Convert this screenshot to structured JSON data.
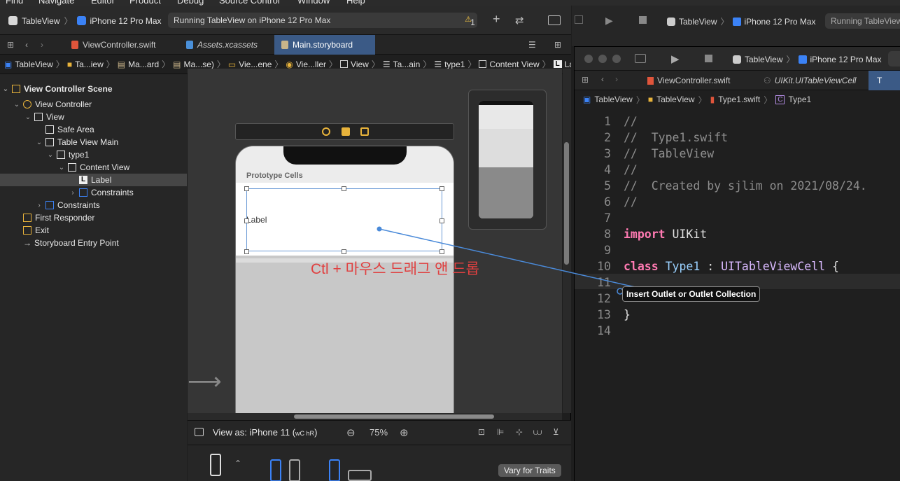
{
  "menubar": {
    "items": [
      "Find",
      "Navigate",
      "Editor",
      "Product",
      "Debug",
      "Source Control",
      "Window",
      "Help"
    ]
  },
  "left_toolbar": {
    "scheme": "TableView",
    "device": "iPhone 12 Pro Max",
    "status": "Running TableView on iPhone 12 Pro Max",
    "warning_count": "1"
  },
  "tabs": [
    {
      "label": "ViewController.swift",
      "active": false
    },
    {
      "label": "Assets.xcassets",
      "active": false
    },
    {
      "label": "Main.storyboard",
      "active": true
    }
  ],
  "jumpbar": [
    "TableView",
    "Ta...iew",
    "Ma...ard",
    "Ma...se)",
    "Vie...ene",
    "Vie...ller",
    "View",
    "Ta...ain",
    "type1",
    "Content View",
    "Label"
  ],
  "outline": [
    {
      "label": "View Controller Scene",
      "level": 0,
      "bold": true
    },
    {
      "label": "View Controller",
      "level": 1
    },
    {
      "label": "View",
      "level": 2
    },
    {
      "label": "Safe Area",
      "level": 3
    },
    {
      "label": "Table View Main",
      "level": 3
    },
    {
      "label": "type1",
      "level": 4
    },
    {
      "label": "Content View",
      "level": 5
    },
    {
      "label": "Label",
      "level": 6,
      "selected": true
    },
    {
      "label": "Constraints",
      "level": 6
    },
    {
      "label": "Constraints",
      "level": 3
    },
    {
      "label": "First Responder",
      "level": 1
    },
    {
      "label": "Exit",
      "level": 1
    },
    {
      "label": "Storyboard Entry Point",
      "level": 1
    }
  ],
  "canvas": {
    "prototype_cells": "Prototype Cells",
    "cell_label": "Label"
  },
  "bottom": {
    "view_as": "View as: iPhone 11 (",
    "view_as_size": "wC hR",
    "view_as_close": ")",
    "zoom": "75%",
    "vary_button": "Vary for Traits"
  },
  "right_back": {
    "scheme": "TableView",
    "device": "iPhone 12 Pro Max",
    "status": "Running TableView"
  },
  "right_window": {
    "scheme": "TableView",
    "device": "iPhone 12 Pro Max",
    "tabs": [
      "ViewController.swift",
      "UIKit.UITableViewCell",
      "T"
    ],
    "jump": [
      "TableView",
      "TableView",
      "Type1.swift",
      "Type1"
    ]
  },
  "code_lines": [
    {
      "n": "1",
      "text": "//"
    },
    {
      "n": "2",
      "text": "//  Type1.swift"
    },
    {
      "n": "3",
      "text": "//  TableView"
    },
    {
      "n": "4",
      "text": "//"
    },
    {
      "n": "5",
      "text": "//  Created by sjlim on 2021/08/24."
    },
    {
      "n": "6",
      "text": "//"
    },
    {
      "n": "7",
      "text": ""
    },
    {
      "n": "8",
      "kw": "import",
      "rest": " UIKit"
    },
    {
      "n": "9",
      "text": ""
    },
    {
      "n": "10",
      "kw": "class",
      "name": "Type1",
      "colon": " : ",
      "super": "UITableViewCell",
      "brace": " {"
    },
    {
      "n": "11",
      "text": ""
    },
    {
      "n": "12",
      "text": ""
    },
    {
      "n": "13",
      "text": "}"
    },
    {
      "n": "14",
      "text": ""
    }
  ],
  "overlay": {
    "annotation": "Ctl + 마우스 드래그 앤 드롭",
    "tooltip": "Insert Outlet or Outlet Collection"
  },
  "colors": {
    "accent": "#3b82f6",
    "annotation": "#e04040",
    "keyword": "#ff7ab2",
    "selected_tab": "#3b5a86"
  }
}
